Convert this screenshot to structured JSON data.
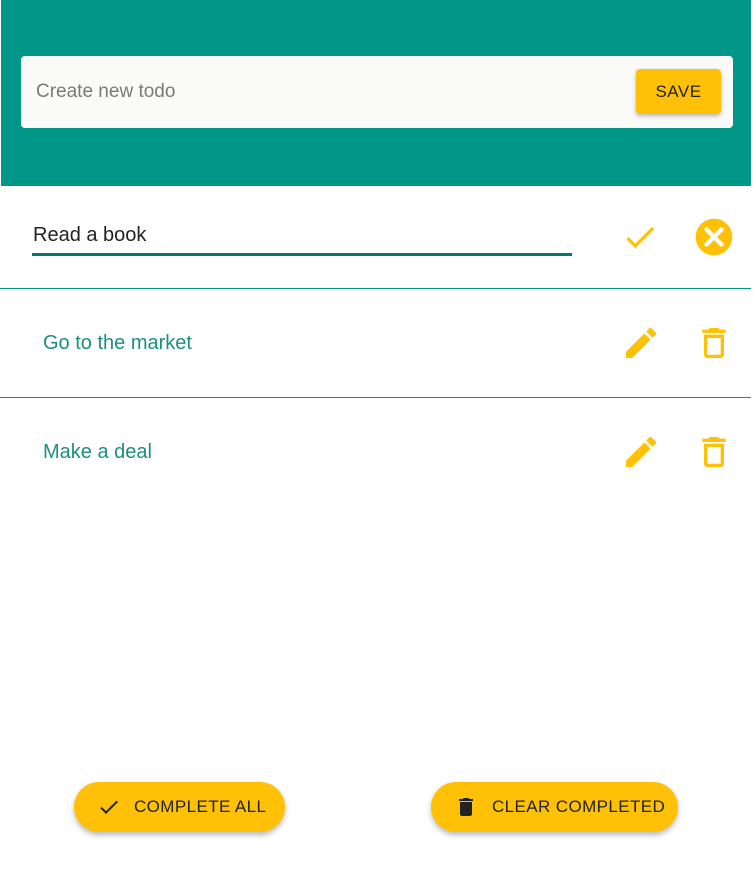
{
  "header": {
    "new_todo": {
      "placeholder": "Create new todo",
      "value": "",
      "save_label": "SAVE"
    }
  },
  "todos": [
    {
      "text": "Read a book",
      "editing": true,
      "actions": [
        "confirm-icon",
        "cancel-icon"
      ]
    },
    {
      "text": "Go to the market",
      "editing": false,
      "actions": [
        "edit-icon",
        "delete-icon"
      ]
    },
    {
      "text": "Make a deal",
      "editing": false,
      "actions": [
        "edit-icon",
        "delete-icon"
      ]
    }
  ],
  "footer": {
    "complete_all_label": "COMPLETE ALL",
    "clear_completed_label": "CLEAR COMPLETED"
  },
  "colors": {
    "header_bg": "#009688",
    "accent": "#ffc107",
    "todo_text": "#1c8f7e",
    "divider": "#009688"
  }
}
